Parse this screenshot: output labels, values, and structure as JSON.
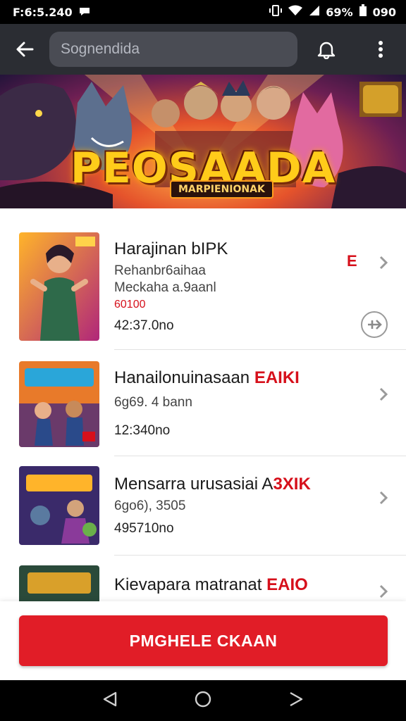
{
  "status": {
    "time": "F:6:5.240",
    "battery": "090",
    "signal_text": "69%"
  },
  "appbar": {
    "search_placeholder": "Sognendida"
  },
  "banner": {
    "title": "PEOSAADA",
    "subtitle": "MARPIENIONAK"
  },
  "items": [
    {
      "title": "Harajinan bIPK",
      "highlight": "",
      "line1": "Rehanbr6aihaa",
      "line2": "Meckaha a.9aanl",
      "red": "60100",
      "price": "42:37.0no",
      "badge": "E"
    },
    {
      "title": "Hanailonuinasaan ",
      "highlight": "EAIKI",
      "line1": "6g69. 4 bann",
      "price": "12:340no"
    },
    {
      "title": "Mensarra urusasiai A",
      "highlight": "3XIK",
      "line1": "6go6), 3505",
      "price": "495710no"
    },
    {
      "title": "Kievapara matranat ",
      "highlight": "EAIO"
    }
  ],
  "cta": {
    "label": "PMGHELE CKAAN"
  },
  "colors": {
    "accent": "#e11d27",
    "appbar": "#2b2d33"
  }
}
